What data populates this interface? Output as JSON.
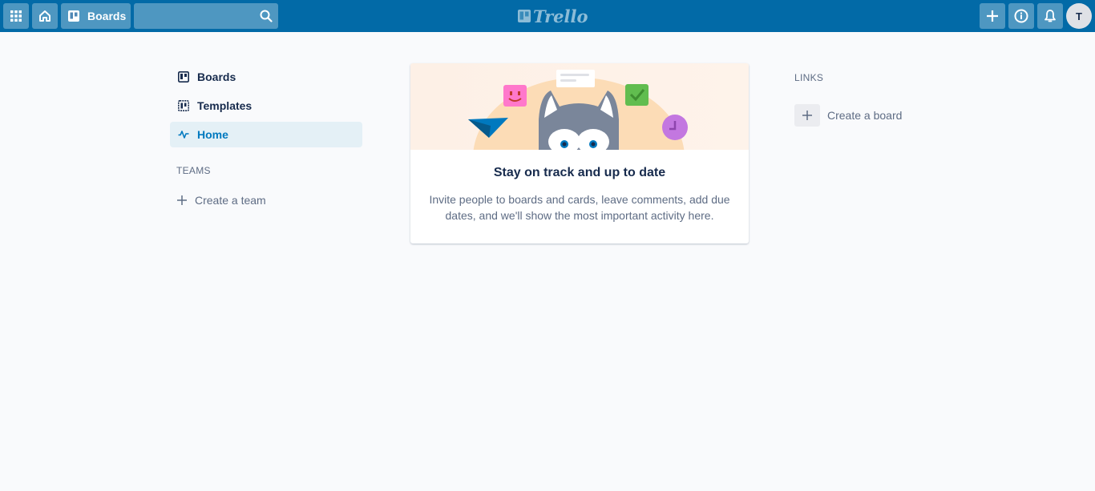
{
  "header": {
    "boards_label": "Boards",
    "search_value": "",
    "logo_text": "Trello",
    "avatar_initial": "T",
    "accent_color": "#026aa7"
  },
  "sidebar": {
    "items": [
      {
        "label": "Boards",
        "icon": "board-icon"
      },
      {
        "label": "Templates",
        "icon": "templates-icon"
      },
      {
        "label": "Home",
        "icon": "activity-icon",
        "active": true
      }
    ],
    "teams_heading": "TEAMS",
    "create_team_label": "Create a team"
  },
  "card": {
    "title": "Stay on track and up to date",
    "text": "Invite people to boards and cards, leave comments, add due dates, and we'll show the most important activity here."
  },
  "links": {
    "heading": "LINKS",
    "create_board_label": "Create a board"
  }
}
